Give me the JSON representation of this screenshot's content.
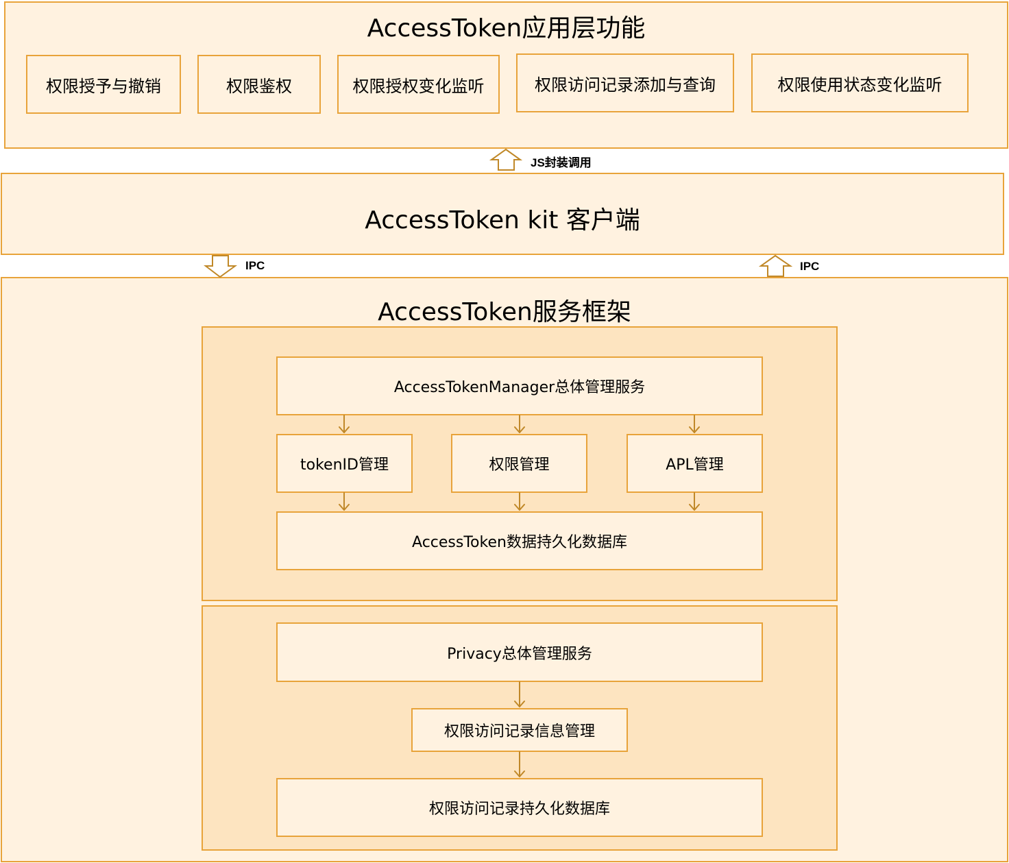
{
  "app_layer": {
    "title": "AccessToken应用层功能",
    "features": [
      "权限授予与撤销",
      "权限鉴权",
      "权限授权变化监听",
      "权限访问记录添加与查询",
      "权限使用状态变化监听"
    ]
  },
  "arrows": {
    "js_label": "JS封装调用",
    "ipc_down_label": "IPC",
    "ipc_up_label": "IPC"
  },
  "kit": {
    "title": "AccessToken kit 客户端"
  },
  "framework": {
    "title": "AccessToken服务框架",
    "access_token_group": {
      "manager": "AccessTokenManager总体管理服务",
      "modules": [
        "tokenID管理",
        "权限管理",
        "APL管理"
      ],
      "database": "AccessToken数据持久化数据库"
    },
    "privacy_group": {
      "manager": "Privacy总体管理服务",
      "record_mgmt": "权限访问记录信息管理",
      "database": "权限访问记录持久化数据库"
    }
  },
  "colors": {
    "border": "#e8a33a",
    "fill_light": "#fff2e0",
    "fill_mid": "#fde4c0",
    "arrow": "#c08828"
  }
}
